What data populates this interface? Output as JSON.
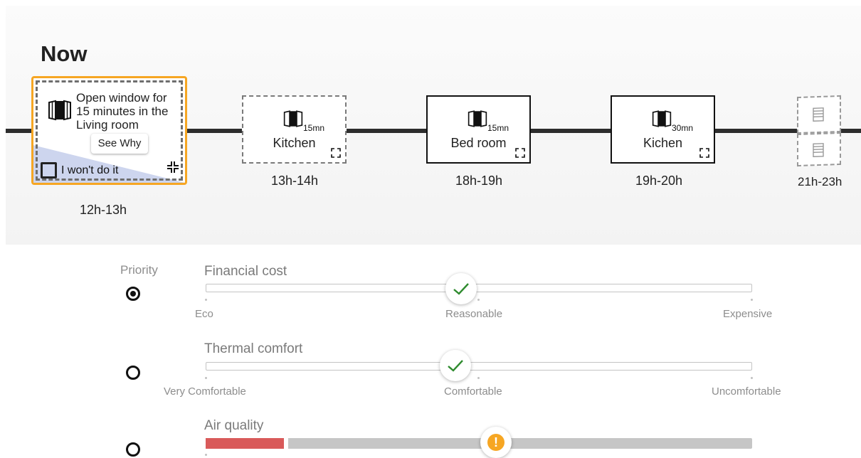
{
  "header": {
    "title": "Now"
  },
  "timeline": {
    "active": {
      "message": "Open window for 15 minutes in the Living room",
      "see_why": "See Why",
      "decline": "I won't do it",
      "time": "12h-13h",
      "icon": "open-window-icon",
      "accent": "#f6a623"
    },
    "cards": [
      {
        "room": "Kitchen",
        "duration": "15mn",
        "time": "13h-14h",
        "style": "dashed"
      },
      {
        "room": "Bed room",
        "duration": "15mn",
        "time": "18h-19h",
        "style": "solid"
      },
      {
        "room": "Kichen",
        "duration": "30mn",
        "time": "19h-20h",
        "style": "solid"
      }
    ],
    "future": {
      "time": "21h-23h",
      "icon": "radiator-icon"
    }
  },
  "priority": {
    "label": "Priority",
    "criteria": [
      {
        "title": "Financial cost",
        "selected": true,
        "ticks": [
          "Eco",
          "Reasonable",
          "Expensive"
        ],
        "value": "Reasonable",
        "status": "ok",
        "status_color": "#2e8b2e"
      },
      {
        "title": "Thermal comfort",
        "selected": false,
        "ticks": [
          "Very Comfortable",
          "Comfortable",
          "Uncomfortable"
        ],
        "value": "Comfortable",
        "status": "ok",
        "status_color": "#2e8b2e"
      },
      {
        "title": "Air quality",
        "selected": false,
        "ticks": [
          "",
          "",
          ""
        ],
        "value_fraction": 0.14,
        "status": "warning",
        "status_color": "#f6a623",
        "warning_glyph": "!"
      }
    ]
  }
}
